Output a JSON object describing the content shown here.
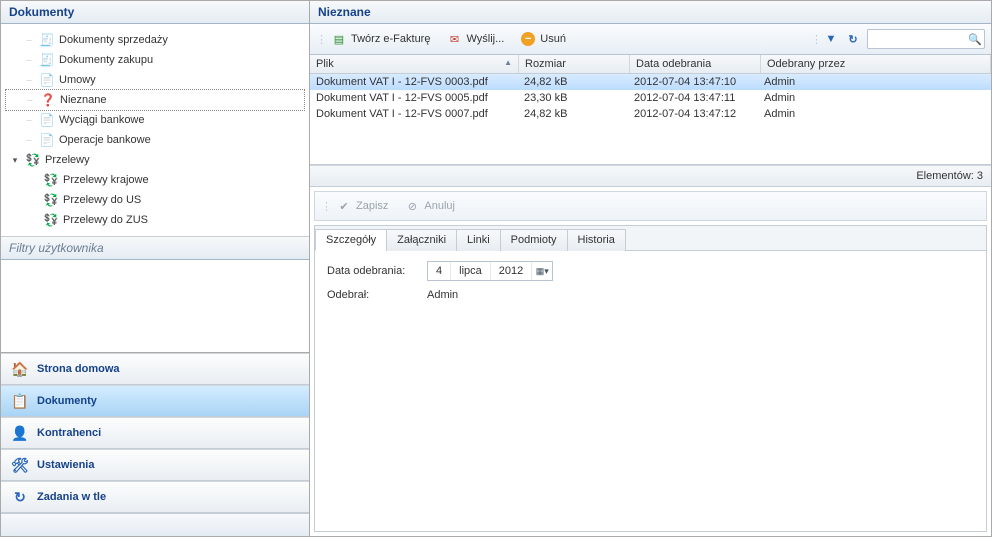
{
  "left": {
    "title": "Dokumenty",
    "tree": [
      {
        "icon": "🧾",
        "label": "Dokumenty sprzedaży"
      },
      {
        "icon": "🧾",
        "label": "Dokumenty zakupu"
      },
      {
        "icon": "📄",
        "label": "Umowy"
      },
      {
        "icon": "❓",
        "label": "Nieznane",
        "selected": true,
        "iconColor": "#c23a2a"
      },
      {
        "icon": "📄",
        "label": "Wyciągi bankowe"
      },
      {
        "icon": "📄",
        "label": "Operacje bankowe"
      },
      {
        "icon": "💱",
        "label": "Przelewy",
        "exp": "▾",
        "iconColor": "#2a8a2a"
      },
      {
        "icon": "💱",
        "label": "Przelewy krajowe",
        "child": true,
        "iconColor": "#2a8a2a"
      },
      {
        "icon": "💱",
        "label": "Przelewy do US",
        "child": true,
        "iconColor": "#c23a2a"
      },
      {
        "icon": "💱",
        "label": "Przelewy do ZUS",
        "child": true,
        "iconColor": "#2a8a2a"
      }
    ],
    "filtersTitle": "Filtry użytkownika",
    "nav": [
      {
        "icon": "🏠",
        "label": "Strona domowa"
      },
      {
        "icon": "📋",
        "label": "Dokumenty",
        "active": true
      },
      {
        "icon": "👤",
        "label": "Kontrahenci",
        "iconColor": "#e08a1a"
      },
      {
        "icon": "🛠",
        "label": "Ustawienia",
        "iconColor": "#2a66b8"
      },
      {
        "icon": "↻",
        "label": "Zadania w tle",
        "iconColor": "#2a66b8"
      }
    ]
  },
  "right": {
    "title": "Nieznane",
    "toolbar": {
      "create": "Twórz e-Fakturę",
      "send": "Wyślij...",
      "delete": "Usuń"
    },
    "grid": {
      "cols": [
        "Plik",
        "Rozmiar",
        "Data odebrania",
        "Odebrany przez"
      ],
      "rows": [
        {
          "file": "Dokument VAT I - 12-FVS 0003.pdf",
          "size": "24,82 kB",
          "date": "2012-07-04 13:47:10",
          "by": "Admin",
          "sel": true
        },
        {
          "file": "Dokument VAT I - 12-FVS 0005.pdf",
          "size": "23,30 kB",
          "date": "2012-07-04 13:47:11",
          "by": "Admin"
        },
        {
          "file": "Dokument VAT I - 12-FVS 0007.pdf",
          "size": "24,82 kB",
          "date": "2012-07-04 13:47:12",
          "by": "Admin"
        }
      ],
      "footer": "Elementów: 3"
    },
    "detailToolbar": {
      "save": "Zapisz",
      "cancel": "Anuluj"
    },
    "tabs": [
      "Szczegóły",
      "Załączniki",
      "Linki",
      "Podmioty",
      "Historia"
    ],
    "details": {
      "dateLabel": "Data odebrania:",
      "day": "4",
      "month": "lipca",
      "year": "2012",
      "receivedLabel": "Odebrał:",
      "receivedBy": "Admin"
    }
  }
}
